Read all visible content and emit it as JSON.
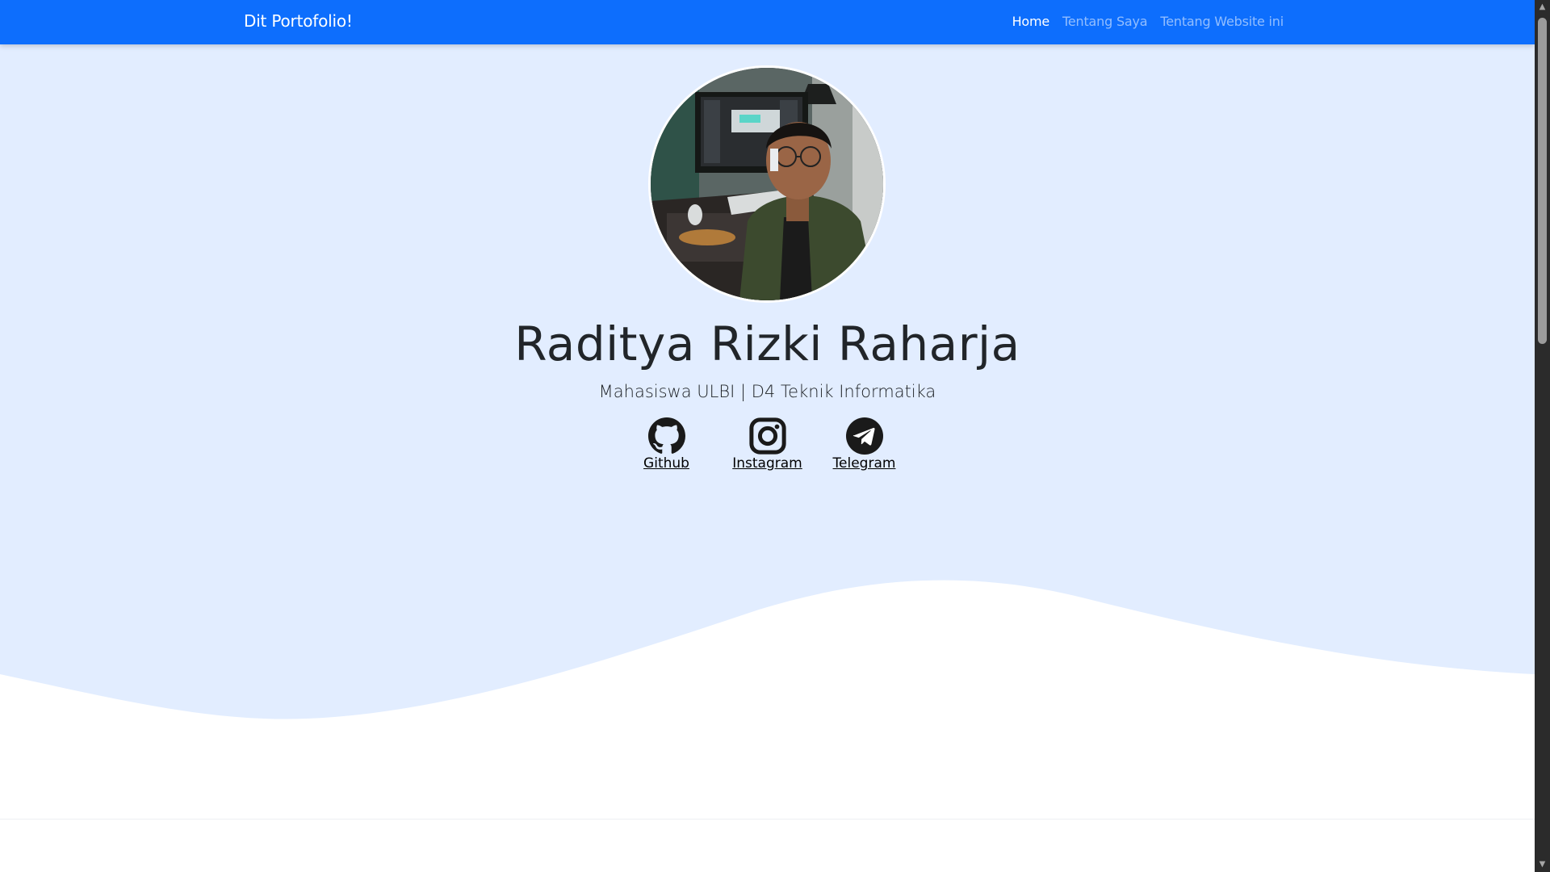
{
  "navbar": {
    "brand": "Dit Portofolio!",
    "links": [
      {
        "label": "Home",
        "active": true
      },
      {
        "label": "Tentang Saya",
        "active": false
      },
      {
        "label": "Tentang Website ini",
        "active": false
      }
    ]
  },
  "hero": {
    "name": "Raditya Rizki Raharja",
    "subtitle": "Mahasiswa ULBI | D4 Teknik Informatika",
    "social": [
      {
        "label": "Github",
        "icon": "github-icon"
      },
      {
        "label": "Instagram",
        "icon": "instagram-icon"
      },
      {
        "label": "Telegram",
        "icon": "telegram-icon"
      }
    ]
  },
  "colors": {
    "navbar": "#0d6efd",
    "hero_background": "#e2edff",
    "wave": "#ffffff",
    "text": "#212529"
  }
}
